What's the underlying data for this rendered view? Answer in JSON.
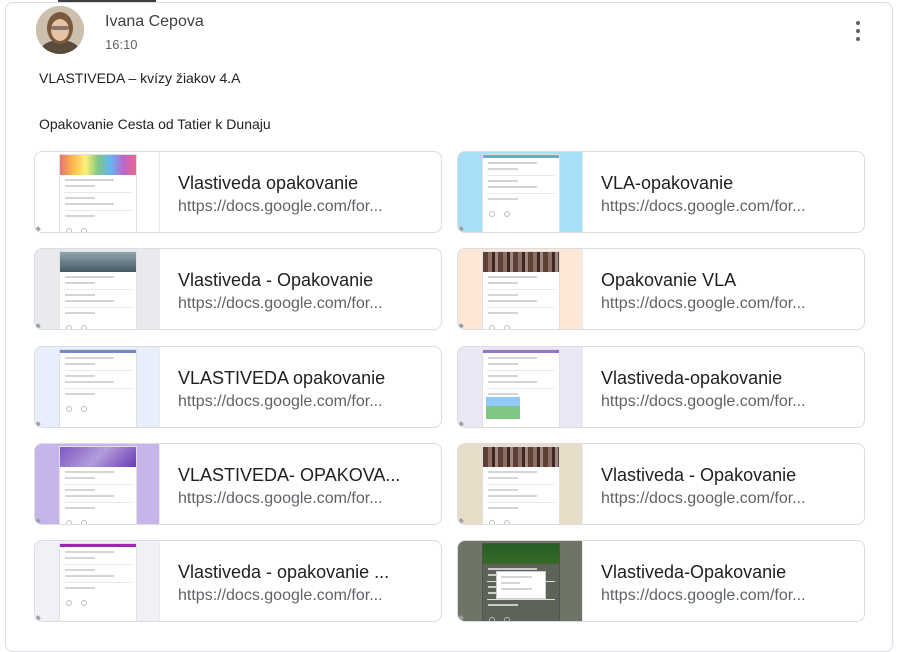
{
  "post": {
    "author": "Ivana Cepova",
    "time": "16:10",
    "line1": "VLASTIVEDA – kvízy žiakov 4.A",
    "line2": "Opakovanie Cesta od Tatier k Dunaju",
    "menu_icon": "more-vert-icon"
  },
  "attachments": [
    {
      "title": "Vlastiveda opakovanie",
      "url": "https://docs.google.com/for...",
      "thumb": "colorful-header",
      "bg": "#ffffff",
      "accent": "#e57373"
    },
    {
      "title": "VLA-opakovanie",
      "url": "https://docs.google.com/for...",
      "thumb": "light-blue",
      "bg": "#a6dff7",
      "accent": "#4fb3e0"
    },
    {
      "title": "Vlastiveda - Opakovanie",
      "url": "https://docs.google.com/for...",
      "thumb": "mountains-header",
      "bg": "#e8eaed",
      "accent": "#607d8b"
    },
    {
      "title": "Opakovanie VLA",
      "url": "https://docs.google.com/for...",
      "thumb": "books-header",
      "bg": "#fde7d6",
      "accent": "#8d6e63"
    },
    {
      "title": "VLASTIVEDA opakovanie",
      "url": "https://docs.google.com/for...",
      "thumb": "light-lavender",
      "bg": "#e8eefc",
      "accent": "#7986cb"
    },
    {
      "title": "Vlastiveda-opakovanie",
      "url": "https://docs.google.com/for...",
      "thumb": "mountain-photo",
      "bg": "#ebe7f5",
      "accent": "#9575cd"
    },
    {
      "title": "VLASTIVEDA- OPAKOVA...",
      "url": "https://docs.google.com/for...",
      "thumb": "purple-header",
      "bg": "#c6b5ea",
      "accent": "#7e57c2"
    },
    {
      "title": "Vlastiveda - Opakovanie",
      "url": "https://docs.google.com/for...",
      "thumb": "books-beige",
      "bg": "#e7ddc9",
      "accent": "#795548"
    },
    {
      "title": "Vlastiveda - opakovanie ...",
      "url": "https://docs.google.com/for...",
      "thumb": "white-purple",
      "bg": "#f2f0f7",
      "accent": "#9c27b0"
    },
    {
      "title": "Vlastiveda-Opakovanie",
      "url": "https://docs.google.com/for...",
      "thumb": "forest-dark",
      "bg": "#6f7566",
      "accent": "#2e5d33"
    }
  ]
}
